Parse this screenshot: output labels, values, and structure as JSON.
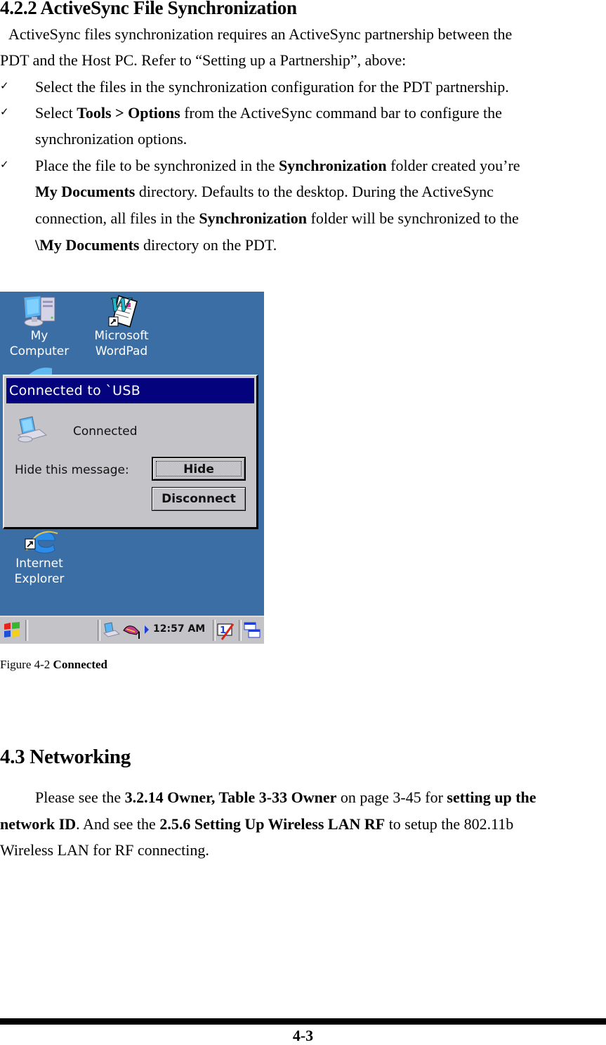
{
  "section_422": {
    "heading": "4.2.2 ActiveSync File Synchronization",
    "intro_line1": "ActiveSync files synchronization requires an ActiveSync partnership between the",
    "intro_line2": "PDT and the Host PC. Refer to “Setting up a Partnership”, above:",
    "bullet_glyph": "✓",
    "bullets": [
      {
        "lines": [
          {
            "parts": [
              {
                "t": "Select the files in the synchronization configuration for the PDT partnership.",
                "b": false
              }
            ]
          }
        ]
      },
      {
        "lines": [
          {
            "parts": [
              {
                "t": "Select ",
                "b": false
              },
              {
                "t": "Tools > Options",
                "b": true
              },
              {
                "t": " from the ActiveSync command bar to configure the",
                "b": false
              }
            ]
          },
          {
            "parts": [
              {
                "t": "synchronization options.",
                "b": false
              }
            ]
          }
        ]
      },
      {
        "lines": [
          {
            "parts": [
              {
                "t": "Place the file to be synchronized in the ",
                "b": false
              },
              {
                "t": "Synchronization",
                "b": true
              },
              {
                "t": " folder created you’re",
                "b": false
              }
            ]
          },
          {
            "parts": [
              {
                "t": "My Documents",
                "b": true
              },
              {
                "t": " directory. Defaults to the desktop. During the ActiveSync",
                "b": false
              }
            ]
          },
          {
            "parts": [
              {
                "t": "connection, all files in the ",
                "b": false
              },
              {
                "t": "Synchronization",
                "b": true
              },
              {
                "t": " folder will be synchronized to the",
                "b": false
              }
            ]
          },
          {
            "parts": [
              {
                "t": "\\My Documents",
                "b": true
              },
              {
                "t": " directory on the PDT.",
                "b": false
              }
            ]
          }
        ]
      }
    ]
  },
  "screen": {
    "desktop_icons": [
      {
        "name": "my-computer",
        "label_line1": "My",
        "label_line2": "Computer"
      },
      {
        "name": "microsoft-wordpad",
        "label_line1": "Microsoft",
        "label_line2": "WordPad"
      },
      {
        "name": "internet-explorer",
        "label_line1": "Internet",
        "label_line2": "Explorer"
      }
    ],
    "dialog": {
      "title": "Connected to `USB",
      "status": "Connected",
      "hide_prompt": "Hide this message:",
      "hide_button": "Hide",
      "disconnect_button": "Disconnect"
    },
    "taskbar": {
      "clock": "12:57 AM"
    },
    "colors": {
      "desktop": "#3a6ea5",
      "titlebar": "#04027c",
      "dialog_face": "#c4c3c8"
    }
  },
  "figure": {
    "caption_prefix": "Figure 4-2 ",
    "caption_bold": "Connected"
  },
  "section_43": {
    "heading": "4.3 Networking",
    "lines": [
      {
        "parts": [
          {
            "t": "Please see the ",
            "b": false
          },
          {
            "t": "3.2.14 Owner, Table 3-33 Owner",
            "b": true
          },
          {
            "t": " on page 3-45 for ",
            "b": false
          },
          {
            "t": "setting up the",
            "b": true
          }
        ]
      },
      {
        "parts": [
          {
            "t": "network ID",
            "b": true
          },
          {
            "t": ". And see the ",
            "b": false
          },
          {
            "t": "2.5.6 Setting Up Wireless LAN RF",
            "b": true
          },
          {
            "t": " to setup the 802.11b",
            "b": false
          }
        ]
      },
      {
        "parts": [
          {
            "t": "Wireless LAN for RF connecting.",
            "b": false
          }
        ]
      }
    ]
  },
  "footer": {
    "page_number": "4-3"
  }
}
